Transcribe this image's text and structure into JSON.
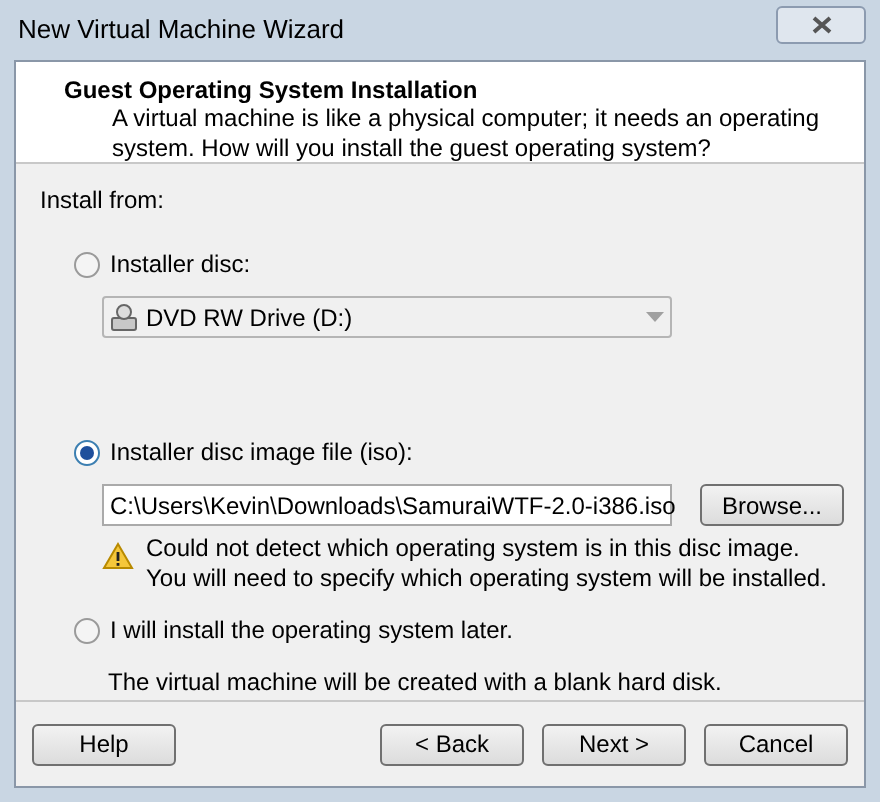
{
  "window": {
    "title": "New Virtual Machine Wizard"
  },
  "header": {
    "title": "Guest Operating System Installation",
    "description": "A virtual machine is like a physical computer; it needs an operating system. How will you install the guest operating system?"
  },
  "install_from": "Install from:",
  "options": [
    {
      "kind": "disc",
      "label": "Installer disc:",
      "selected": false,
      "drive": {
        "value": "DVD RW Drive (D:)",
        "disabled": true
      }
    },
    {
      "kind": "iso",
      "label": "Installer disc image file (iso):",
      "selected": true,
      "path": "C:\\Users\\Kevin\\Downloads\\SamuraiWTF-2.0-i386.iso",
      "browse": "Browse...",
      "warning": [
        "Could not detect which operating system is in this disc image.",
        "You will need to specify which operating system will be installed."
      ]
    },
    {
      "kind": "later",
      "label": "I will install the operating system later.",
      "selected": false,
      "note": "The virtual machine will be created with a blank hard disk."
    }
  ],
  "buttons": [
    {
      "label": "Help"
    },
    {
      "label": "< Back"
    },
    {
      "label": "Next >"
    },
    {
      "label": "Cancel"
    }
  ]
}
